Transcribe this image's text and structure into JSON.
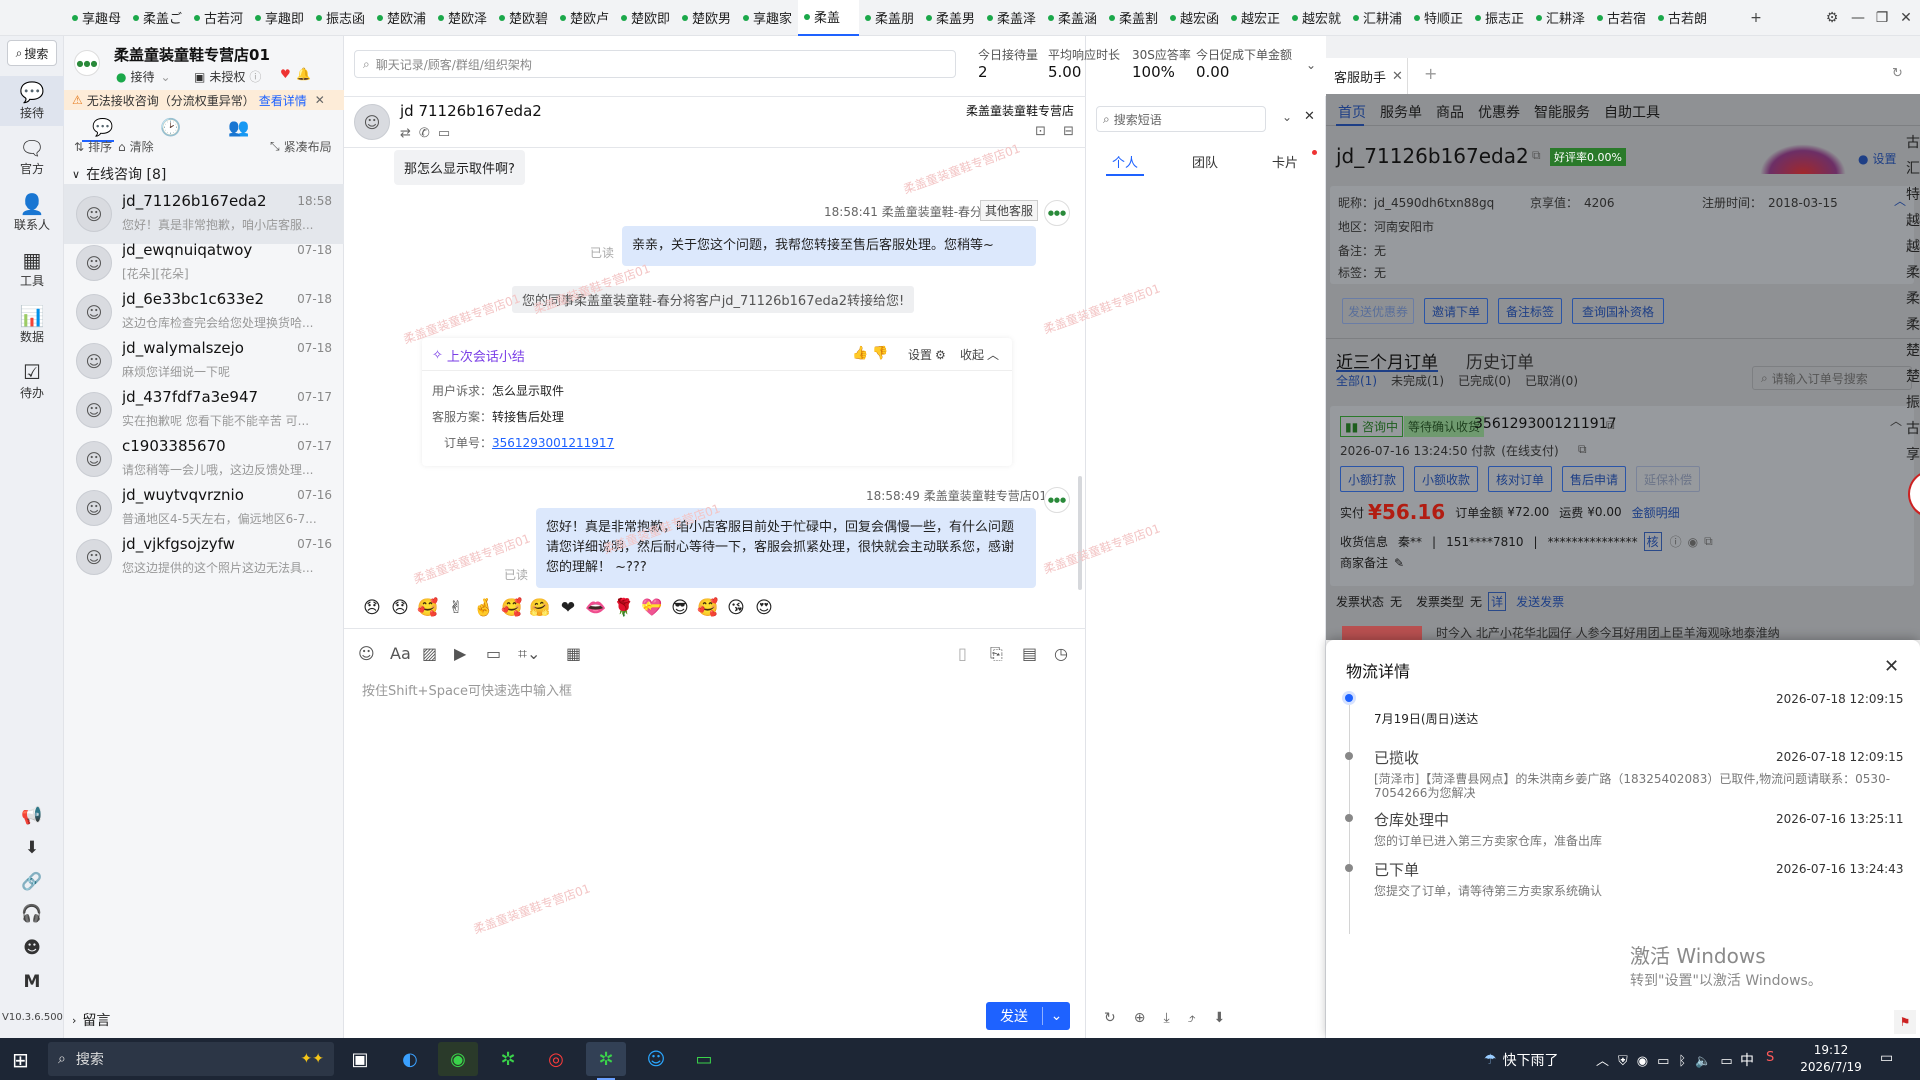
{
  "top_tabs": [
    "享趣母",
    "柔盖ご",
    "古若河",
    "享趣即",
    "振志函",
    "楚欧浦",
    "楚欧泽",
    "楚欧碧",
    "楚欧卢",
    "楚欧即",
    "楚欧男",
    "享趣家",
    "柔盖",
    "柔盖朋",
    "柔盖男",
    "柔盖泽",
    "柔盖涵",
    "柔盖割",
    "越宏函",
    "越宏正",
    "越宏就",
    "汇耕浦",
    "特顺正",
    "振志正",
    "汇耕泽",
    "古若宿",
    "古若朗"
  ],
  "active_top_tab_index": 12,
  "window": {
    "add_tab": "+",
    "settings": "⚙",
    "minimize": "—",
    "maximize": "❐",
    "close": "✕"
  },
  "rail": {
    "search": "搜索",
    "items": [
      {
        "label": "接待",
        "icon": "💬"
      },
      {
        "label": "官方",
        "icon": "🗨"
      },
      {
        "label": "联系人",
        "icon": "👤"
      },
      {
        "label": "工具",
        "icon": "▦"
      },
      {
        "label": "数据",
        "icon": "📊"
      },
      {
        "label": "待办",
        "icon": "☑"
      }
    ],
    "bottom_icons": [
      "📢",
      "⬇",
      "🔗",
      "🎧",
      "☻",
      "M"
    ],
    "version": "V10.3.6.500"
  },
  "shop": {
    "name": "柔盖童装童鞋专营店01",
    "status": "接待",
    "auth": "未授权",
    "alert": "无法接收咨询（分流权重异常）",
    "alert_link": "查看详情",
    "sort": "排序",
    "clear": "清除",
    "layout": "紧凑布局",
    "online_group": "在线咨询 [8]",
    "leave_msg": "留言"
  },
  "sessions": [
    {
      "name": "jd_71126b167eda2",
      "time": "18:58",
      "msg": "您好！真是非常抱歉，咱小店客服..."
    },
    {
      "name": "jd_ewqnuiqatwoy",
      "time": "07-18",
      "msg": "[花朵][花朵]"
    },
    {
      "name": "jd_6e33bc1c633e2",
      "time": "07-18",
      "msg": "这边仓库检查完会给您处理换货哈..."
    },
    {
      "name": "jd_walymalszejo",
      "time": "07-18",
      "msg": "麻烦您详细说一下呢"
    },
    {
      "name": "jd_437fdf7a3e947",
      "time": "07-17",
      "msg": "实在抱歉呢 您看下能不能辛苦 可..."
    },
    {
      "name": "c1903385670",
      "time": "07-17",
      "msg": "请您稍等一会儿哦，这边反馈处理..."
    },
    {
      "name": "jd_wuytvqvrznio",
      "time": "07-16",
      "msg": "普通地区4-5天左右，偏远地区6-7..."
    },
    {
      "name": "jd_vjkfgsojzyfw",
      "time": "07-16",
      "msg": "您这边提供的这个照片这边无法具..."
    }
  ],
  "chat": {
    "search_placeholder": "聊天记录/顾客/群组/组织架构",
    "stats": [
      {
        "label": "今日接待量",
        "value": "2"
      },
      {
        "label": "平均响应时长",
        "value": "5.00"
      },
      {
        "label": "30S应答率",
        "value": "100%"
      },
      {
        "label": "今日促成下单金额",
        "value": "0.00"
      }
    ],
    "customer": "jd 71126b167eda2",
    "shop_label": "柔盖童装童鞋专营店",
    "msg_customer": "那怎么显示取件啊?",
    "msg1_meta": "18:58:41  柔盖童装童鞋-春分",
    "msg1_tag": "其他客服",
    "msg1_text": "亲亲，关于您这个问题，我帮您转接至售后客服处理。您稍等~",
    "read": "已读",
    "transfer_note": "您的同事柔盖童装童鞋-春分将客户jd_71126b167eda2转接给您!",
    "summary": {
      "title": "上次会话小结",
      "settings": "设置",
      "collapse": "收起",
      "complaint_label": "用户诉求：",
      "complaint": "怎么显示取件",
      "plan_label": "客服方案：",
      "plan": "转接售后处理",
      "order_label": "订单号：",
      "order": "3561293001211917"
    },
    "msg2_meta": "18:58:49  柔盖童装童鞋专营店01",
    "msg2_text": "您好！真是非常抱歉，咱小店客服目前处于忙碌中，回复会偶慢一些，有什么问题请您详细说明，然后耐心等待一下，客服会抓紧处理，很快就会主动联系您，感谢您的理解！ ~???",
    "emojis": [
      "😞",
      "😞",
      "🥰",
      "✌",
      "🤞",
      "🥰",
      "🤗",
      "❤",
      "👄",
      "🌹",
      "💝",
      "😎",
      "🥰",
      "😘",
      "😍"
    ],
    "input_placeholder": "按住Shift+Space可快速选中输入框",
    "send": "发送"
  },
  "quick": {
    "search_placeholder": "搜索短语",
    "tabs": [
      "个人",
      "团队",
      "卡片"
    ]
  },
  "assistant": {
    "tab": "客服助手",
    "nav": [
      "首页",
      "服务单",
      "商品",
      "优惠券",
      "智能服务",
      "自助工具"
    ],
    "customer": "jd_71126b167eda2",
    "rating_badge": "好评率0.00%",
    "setting": "设置",
    "nick_label": "昵称：",
    "nick": "jd_4590dh6txn88gq",
    "jd_label": "京享值：",
    "jd_value": "4206",
    "reg_label": "注册时间：",
    "reg": "2018-03-15",
    "region_label": "地区：",
    "region": "河南安阳市",
    "remark_label": "备注：",
    "remark": "无",
    "tag_label": "标签：",
    "tag": "无",
    "buttons": [
      "发送优惠券",
      "邀请下单",
      "备注标签",
      "查询国补资格"
    ],
    "orders_tab": "近三个月订单",
    "history_tab": "历史订单",
    "filters": [
      "全部(1)",
      "未完成(1)",
      "已完成(0)",
      "已取消(0)"
    ],
    "order_search": "请输入订单号搜索",
    "order_status": "咨询中",
    "order_tag": "等待确认收货",
    "order_no": "3561293001211917",
    "order_time": "2026-07-16 13:24:50 付款",
    "order_pay": "(在线支付)",
    "order_btns": [
      "小额打款",
      "小额收款",
      "核对订单",
      "售后申请",
      "延保补偿"
    ],
    "paid_label": "实付",
    "paid": "¥56.16",
    "total_label": "订单金额",
    "total": "¥72.00",
    "freight_label": "运费",
    "freight": "¥0.00",
    "detail": "金额明细",
    "recv_label": "收货信息",
    "recv_name": "秦**",
    "recv_phone": "151****7810",
    "recv_addr": "***************",
    "recv_tag": "核",
    "merchant_note": "商家备注",
    "invoice_status_label": "发票状态",
    "invoice_status": "无",
    "invoice_type_label": "发票类型",
    "invoice_type": "无",
    "invoice_tag": "详",
    "invoice_send": "发送发票",
    "product_line": "时今入 北产小花华北园仔 人参今耳好用团上臣羊海观咏地泰淮纳"
  },
  "logistics": {
    "title": "物流详情",
    "events": [
      {
        "title": "",
        "time": "2026-07-18 12:09:15",
        "desc": "7月19日(周日)送达"
      },
      {
        "title": "已揽收",
        "time": "2026-07-18 12:09:15",
        "desc": "[菏泽市]【菏泽曹县网点】的朱洪南乡姜广路（18325402083）已取件,物流问题请联系：0530-7054266为您解决"
      },
      {
        "title": "仓库处理中",
        "time": "2026-07-16 13:25:11",
        "desc": "您的订单已进入第三方卖家仓库，准备出库"
      },
      {
        "title": "已下单",
        "time": "2026-07-16 13:24:43",
        "desc": "您提交了订单，请等待第三方卖家系统确认"
      }
    ],
    "activate_title": "激活 Windows",
    "activate_sub": "转到\"设置\"以激活 Windows。"
  },
  "taskbar": {
    "search": "搜索",
    "weather": "快下雨了",
    "ime": "中",
    "time": "19:12",
    "date": "2026/7/19"
  },
  "right_edge_chars": [
    "古",
    "汇",
    "特",
    "越",
    "越",
    "柔",
    "柔",
    "柔",
    "楚",
    "楚",
    "振",
    "古",
    "享"
  ],
  "watermark": "柔盖童装童鞋专营店01",
  "colors": {
    "accent": "#1e62ff",
    "price": "#e0261a",
    "tab_dot": "#1ba84a"
  }
}
